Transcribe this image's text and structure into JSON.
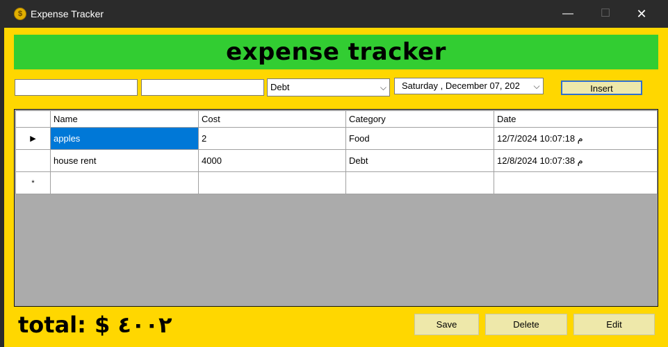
{
  "window": {
    "title": "Expense Tracker",
    "app_icon": "$",
    "minimize_glyph": "—",
    "maximize_glyph": "☐",
    "close_glyph": "✕"
  },
  "header": {
    "banner_text": "expense tracker"
  },
  "form": {
    "name_input_value": "",
    "cost_input_value": "",
    "category_selected": "Debt",
    "date_value": "Saturday   , December 07, 202",
    "dropdown_glyph": "⌵",
    "insert_label": "Insert"
  },
  "grid": {
    "columns": [
      "Name",
      "Cost",
      "Category",
      "Date"
    ],
    "rows": [
      {
        "indicator": "▶",
        "name": "apples",
        "cost": "2",
        "category": "Food",
        "date": "12/7/2024 10:07:18 م"
      },
      {
        "indicator": "",
        "name": "house rent",
        "cost": "4000",
        "category": "Debt",
        "date": "12/8/2024 10:07:38 م"
      }
    ],
    "new_row_indicator": "*"
  },
  "footer": {
    "total_label": "total:",
    "total_value": "$ ٤٠٠٢",
    "save_label": "Save",
    "delete_label": "Delete",
    "edit_label": "Edit"
  },
  "colors": {
    "background": "#ffd700",
    "banner": "#32cd32",
    "buttons": "#eee8aa",
    "selection": "#0078d7",
    "grid_background": "#ababab",
    "titlebar": "#2b2b2b"
  }
}
